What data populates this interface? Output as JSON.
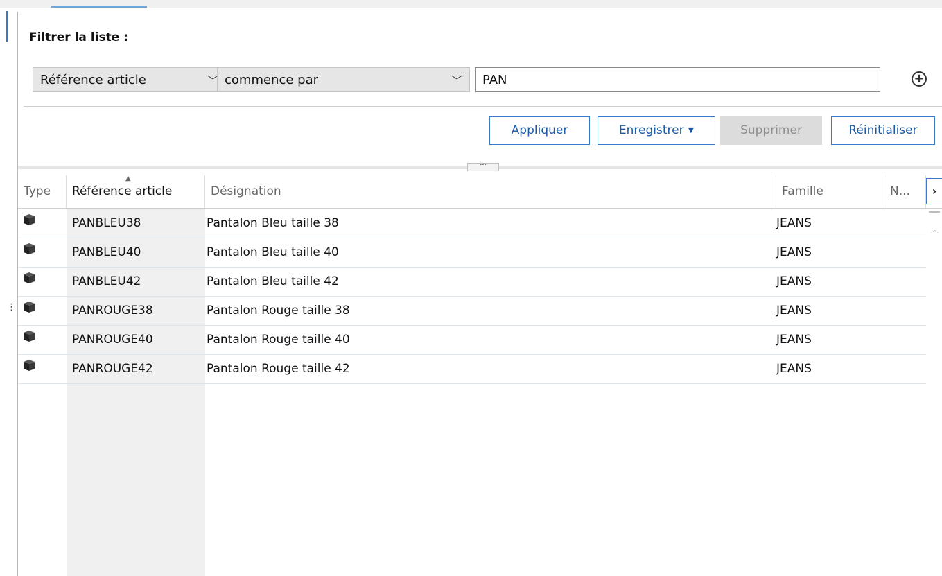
{
  "filter": {
    "title": "Filtrer la liste :",
    "field_select": {
      "value": "Référence article"
    },
    "operator_select": {
      "value": "commence par"
    },
    "value_input": {
      "value": "PAN"
    }
  },
  "actions": {
    "apply": "Appliquer",
    "save": "Enregistrer",
    "delete": "Supprimer",
    "reset": "Réinitialiser"
  },
  "grid": {
    "columns": {
      "type": "Type",
      "reference": "Référence article",
      "designation": "Désignation",
      "family": "Famille",
      "n": "N..."
    },
    "rows": [
      {
        "ref": "PANBLEU38",
        "designation": "Pantalon Bleu taille 38",
        "family": "JEANS",
        "icon": "product-box-icon"
      },
      {
        "ref": "PANBLEU40",
        "designation": "Pantalon Bleu taille 40",
        "family": "JEANS",
        "icon": "product-box-icon"
      },
      {
        "ref": "PANBLEU42",
        "designation": "Pantalon Bleu taille 42",
        "family": "JEANS",
        "icon": "product-box-icon"
      },
      {
        "ref": "PANROUGE38",
        "designation": "Pantalon Rouge taille 38",
        "family": "JEANS",
        "icon": "product-box-icon"
      },
      {
        "ref": "PANROUGE40",
        "designation": "Pantalon Rouge taille 40",
        "family": "JEANS",
        "icon": "product-box-icon"
      },
      {
        "ref": "PANROUGE42",
        "designation": "Pantalon Rouge taille 42",
        "family": "JEANS",
        "icon": "product-box-icon"
      }
    ]
  },
  "colors": {
    "accent": "#3a78c9",
    "disabled_bg": "#dcdcdc"
  }
}
